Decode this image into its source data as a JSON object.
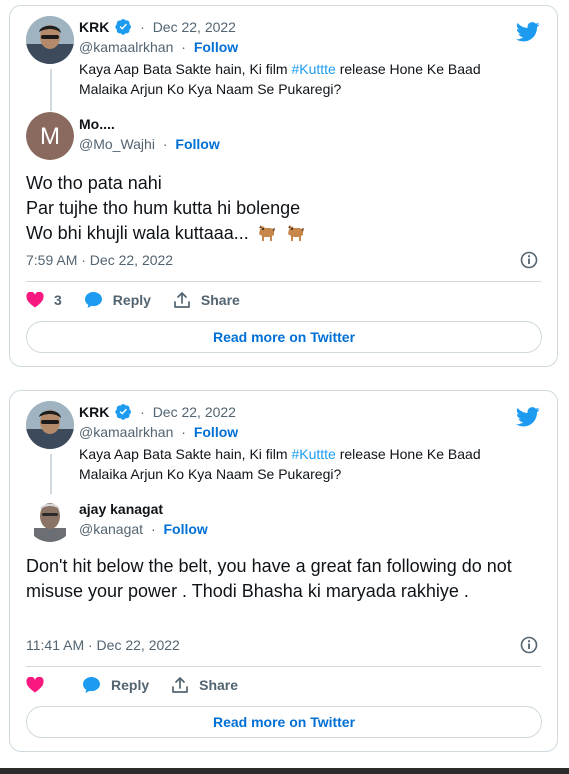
{
  "colors": {
    "link": "#006fd6",
    "hashtag": "#1d9bf0",
    "muted": "#536471",
    "heart": "#f91880",
    "border": "#cfd9de"
  },
  "cards": [
    {
      "parent": {
        "name": "KRK",
        "date": "Dec 22, 2022",
        "handle": "@kamaalrkhan",
        "follow": "Follow",
        "text_before": "Kaya Aap Bata Sakte hain, Ki film ",
        "hashtag": "#Kuttte",
        "text_after": " release Hone Ke Baad Malaika Arjun Ko Kya Naam Se Pukaregi?"
      },
      "reply": {
        "avatar_initial": "M",
        "name": "Mo....",
        "handle": "@Mo_Wajhi",
        "follow": "Follow",
        "lines": [
          "Wo tho pata nahi",
          "Par tujhe tho hum kutta hi bolenge",
          "Wo bhi khujli wala kuttaaa..."
        ],
        "emoji": [
          "dog-emoji",
          "dog-emoji"
        ],
        "timestamp": "7:59 AM · Dec 22, 2022"
      },
      "actions": {
        "like_count": "3",
        "reply": "Reply",
        "share": "Share"
      },
      "read_more": "Read more on Twitter"
    },
    {
      "parent": {
        "name": "KRK",
        "date": "Dec 22, 2022",
        "handle": "@kamaalrkhan",
        "follow": "Follow",
        "text_before": "Kaya Aap Bata Sakte hain, Ki film ",
        "hashtag": "#Kuttte",
        "text_after": " release Hone Ke Baad Malaika Arjun Ko Kya Naam Se Pukaregi?"
      },
      "reply": {
        "name": "ajay kanagat",
        "handle": "@kanagat",
        "follow": "Follow",
        "text": "Don't hit below the belt, you have a great fan following do not misuse your power . Thodi Bhasha ki maryada rakhiye .",
        "timestamp": "11:41 AM · Dec 22, 2022"
      },
      "actions": {
        "like_count": "",
        "reply": "Reply",
        "share": "Share"
      },
      "read_more": "Read more on Twitter"
    }
  ]
}
